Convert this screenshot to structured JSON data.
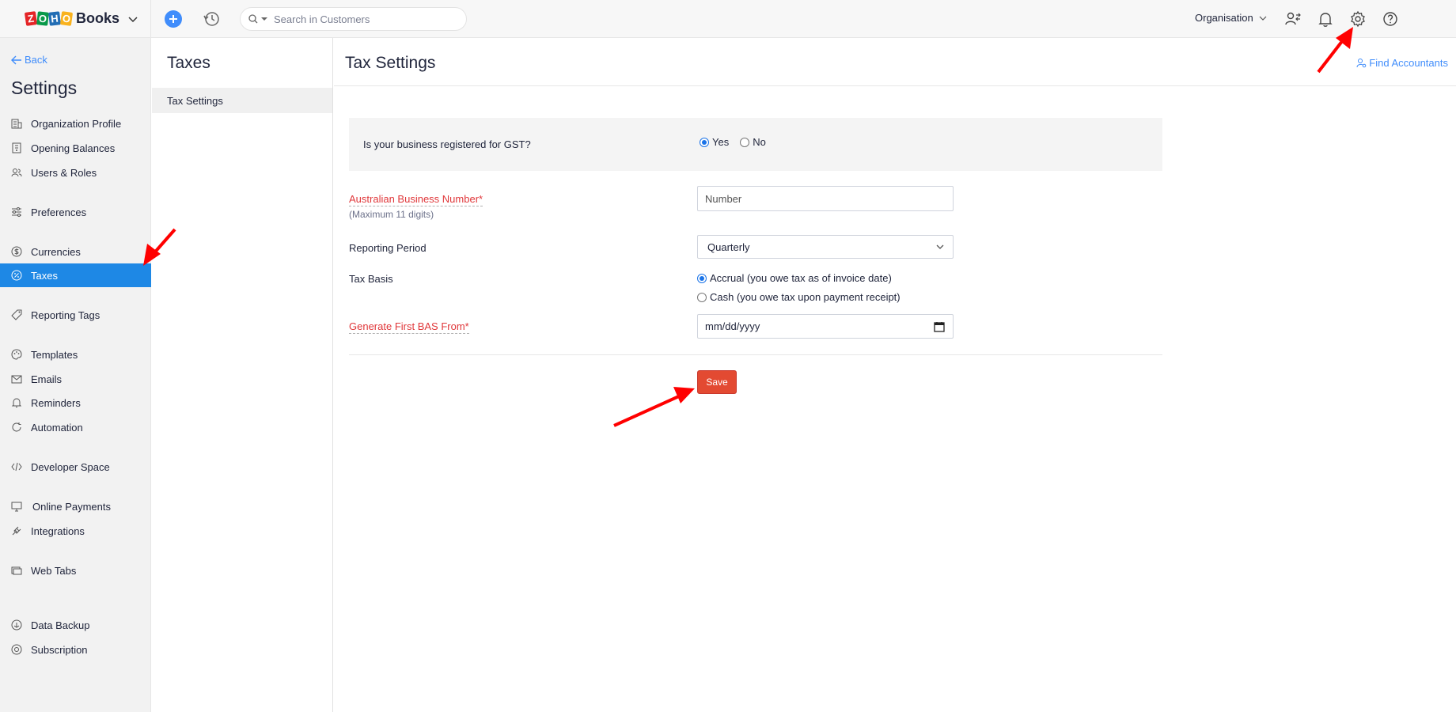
{
  "topbar": {
    "logo_letters": [
      "Z",
      "O",
      "H",
      "O"
    ],
    "app_name": "Books",
    "search_placeholder": "Search in Customers",
    "org_label": "Organisation"
  },
  "sidebar": {
    "back_label": "Back",
    "title": "Settings",
    "items": [
      {
        "label": "Organization Profile",
        "icon": "building-icon"
      },
      {
        "label": "Opening Balances",
        "icon": "ledger-icon"
      },
      {
        "label": "Users & Roles",
        "icon": "users-icon"
      },
      {
        "label": "Preferences",
        "icon": "sliders-icon"
      },
      {
        "label": "Currencies",
        "icon": "currency-icon"
      },
      {
        "label": "Taxes",
        "icon": "percent-icon",
        "active": true
      },
      {
        "label": "Reporting Tags",
        "icon": "tag-icon"
      },
      {
        "label": "Templates",
        "icon": "palette-icon"
      },
      {
        "label": "Emails",
        "icon": "mail-icon"
      },
      {
        "label": "Reminders",
        "icon": "bell-icon"
      },
      {
        "label": "Automation",
        "icon": "refresh-icon"
      },
      {
        "label": "Developer Space",
        "icon": "code-icon"
      },
      {
        "label": "Online Payments",
        "icon": "monitor-icon"
      },
      {
        "label": "Integrations",
        "icon": "plug-icon"
      },
      {
        "label": "Web Tabs",
        "icon": "tabs-icon"
      },
      {
        "label": "Data Backup",
        "icon": "backup-icon"
      },
      {
        "label": "Subscription",
        "icon": "subscription-icon"
      }
    ]
  },
  "subpanel": {
    "title": "Taxes",
    "items": [
      {
        "label": "Tax Settings",
        "selected": true
      }
    ]
  },
  "main": {
    "title": "Tax Settings",
    "find_accountants": "Find Accountants",
    "gst_question": "Is your business registered for GST?",
    "gst_yes": "Yes",
    "gst_no": "No",
    "gst_selected": "Yes",
    "abn_label": "Australian Business Number*",
    "abn_hint": "(Maximum 11 digits)",
    "abn_placeholder": "Number",
    "reporting_period_label": "Reporting Period",
    "reporting_period_value": "Quarterly",
    "tax_basis_label": "Tax Basis",
    "tax_basis_accrual": "Accrual (you owe tax as of invoice date)",
    "tax_basis_cash": "Cash (you owe tax upon payment receipt)",
    "tax_basis_selected": "Accrual",
    "bas_label": "Generate First BAS From*",
    "bas_placeholder": "mm/dd/yyyy",
    "save_label": "Save"
  },
  "colors": {
    "accent": "#408dfb",
    "active_nav": "#1e88e5",
    "save_button": "#e34a32",
    "required_label": "#e0373a",
    "annotation_arrow": "#ff0000"
  }
}
